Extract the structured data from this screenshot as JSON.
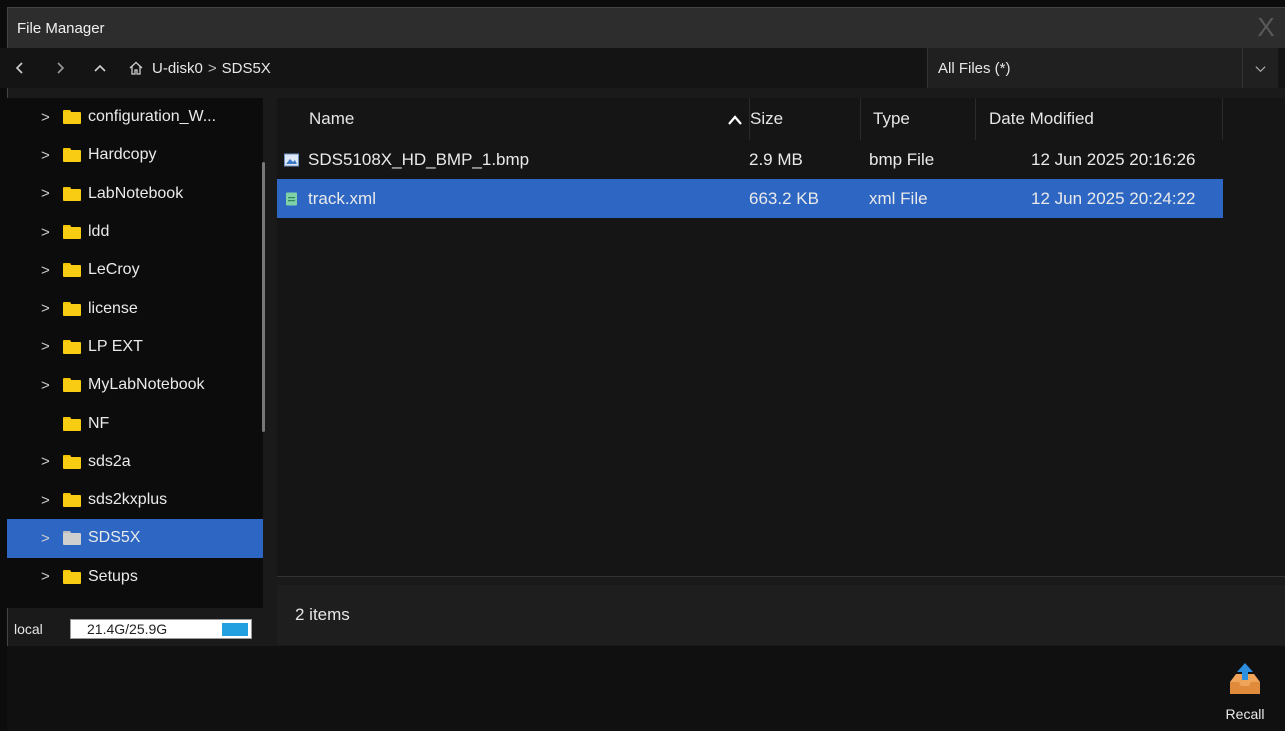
{
  "window": {
    "title": "File Manager",
    "close_glyph": "X"
  },
  "nav": {
    "back_icon": "chevron-left-icon",
    "forward_icon": "chevron-right-icon",
    "up_icon": "chevron-up-icon",
    "home_icon": "home-icon",
    "breadcrumb": [
      "U-disk0",
      "SDS5X"
    ],
    "separator": ">",
    "filter": {
      "selected": "All Files (*)"
    }
  },
  "tree": {
    "items": [
      {
        "label": "configuration_W...",
        "expandable": true
      },
      {
        "label": "Hardcopy",
        "expandable": true
      },
      {
        "label": "LabNotebook",
        "expandable": true
      },
      {
        "label": "ldd",
        "expandable": true
      },
      {
        "label": "LeCroy",
        "expandable": true
      },
      {
        "label": "license",
        "expandable": true
      },
      {
        "label": "LP EXT",
        "expandable": true
      },
      {
        "label": "MyLabNotebook",
        "expandable": true
      },
      {
        "label": "NF",
        "expandable": false
      },
      {
        "label": "sds2a",
        "expandable": true
      },
      {
        "label": "sds2kxplus",
        "expandable": true
      },
      {
        "label": "SDS5X",
        "expandable": true,
        "selected": true
      },
      {
        "label": "Setups",
        "expandable": true
      }
    ]
  },
  "storage": {
    "label": "local",
    "usage": "21.4G/25.9G",
    "used_fraction": 0.83,
    "bar_color": "#22a0e0"
  },
  "list": {
    "columns": {
      "name": "Name",
      "size": "Size",
      "type": "Type",
      "date": "Date Modified"
    },
    "sort": "ascending",
    "rows": [
      {
        "name": "SDS5108X_HD_BMP_1.bmp",
        "size": "2.9 MB",
        "type": "bmp File",
        "date": "12 Jun 2025 20:16:26",
        "icon": "image-file-icon",
        "selected": false
      },
      {
        "name": "track.xml",
        "size": "663.2 KB",
        "type": "xml File",
        "date": "12 Jun 2025 20:24:22",
        "icon": "document-file-icon",
        "selected": true
      }
    ]
  },
  "status": {
    "count_text": "2 items"
  },
  "actions": {
    "recall_label": "Recall",
    "recall_icon": "recall-tray-icon"
  },
  "colors": {
    "selection": "#2e67c3",
    "folder": "#f7cc12",
    "background": "#151515"
  }
}
